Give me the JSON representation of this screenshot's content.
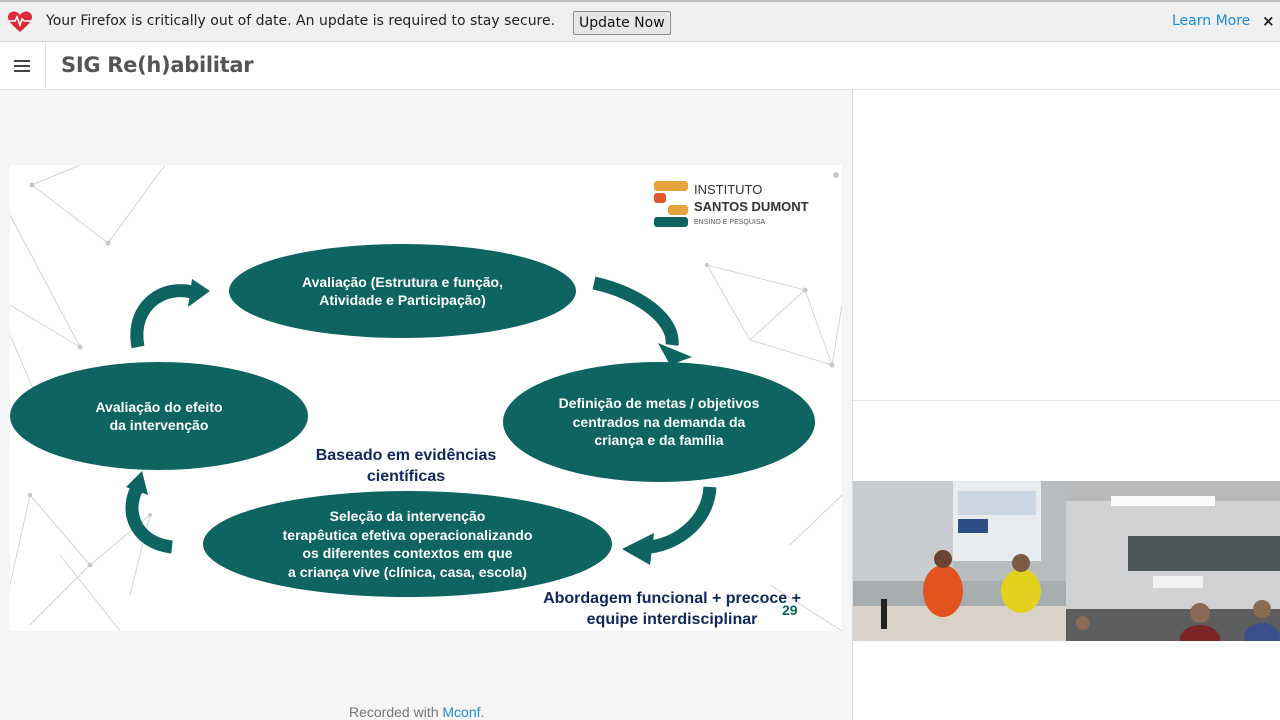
{
  "notification": {
    "message": "Your Firefox is critically out of date. An update is required to stay secure.",
    "update_button": "Update Now",
    "learn_more": "Learn More",
    "close": "×",
    "icon": "heart-pulse-icon"
  },
  "topbar": {
    "menu_icon": "hamburger-menu-icon",
    "title": "SIG Re(h)abilitar"
  },
  "slide": {
    "logo": {
      "line1": "INSTITUTO",
      "line2": "SANTOS DUMONT",
      "line3": "ENSINO E PESQUISA"
    },
    "ellipses": {
      "top": "Avaliação (Estrutura e função,\nAtividade e Participação)",
      "left": "Avaliação do efeito\nda intervenção",
      "right": "Definição de metas / objetivos\ncentrados na demanda da\ncriança e da família",
      "bottom": "Seleção da intervenção\nterapêutica efetiva operacionalizando\nos diferentes contextos em que\na criança vive (clínica, casa, escola)"
    },
    "center_text": "Baseado em evidências\ncientíficas",
    "bottom_text": "Abordagem funcional + precoce +\nequipe interdisciplinar",
    "page_number": "29",
    "accent_color": "#0e6461",
    "text_color": "#10285a"
  },
  "footer": {
    "prefix": "Recorded with ",
    "brand": "Mconf",
    "suffix": "."
  }
}
